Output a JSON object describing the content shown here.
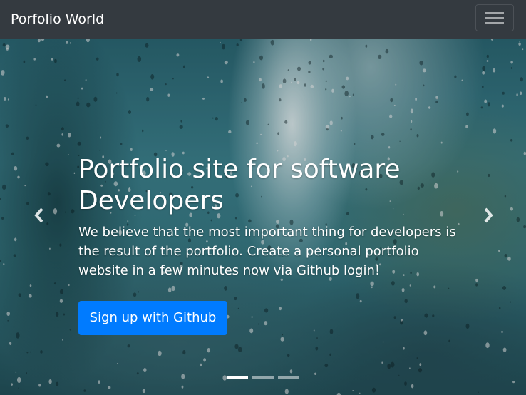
{
  "navbar": {
    "brand": "Porfolio World",
    "toggler_icon": "hamburger-icon"
  },
  "hero": {
    "headline": "Portfolio site for software Developers",
    "lead": "We believe that the most important thing for developers is the result of the portfolio. Create a personal portfolio website in a few minutes now via Github login!",
    "cta_label": "Sign up with Github",
    "prev_icon": "chevron-left-icon",
    "next_icon": "chevron-right-icon",
    "slide_count": 3,
    "active_slide": 1
  },
  "colors": {
    "navbar_bg": "#343a40",
    "primary": "#007bff",
    "text": "#ffffff"
  }
}
